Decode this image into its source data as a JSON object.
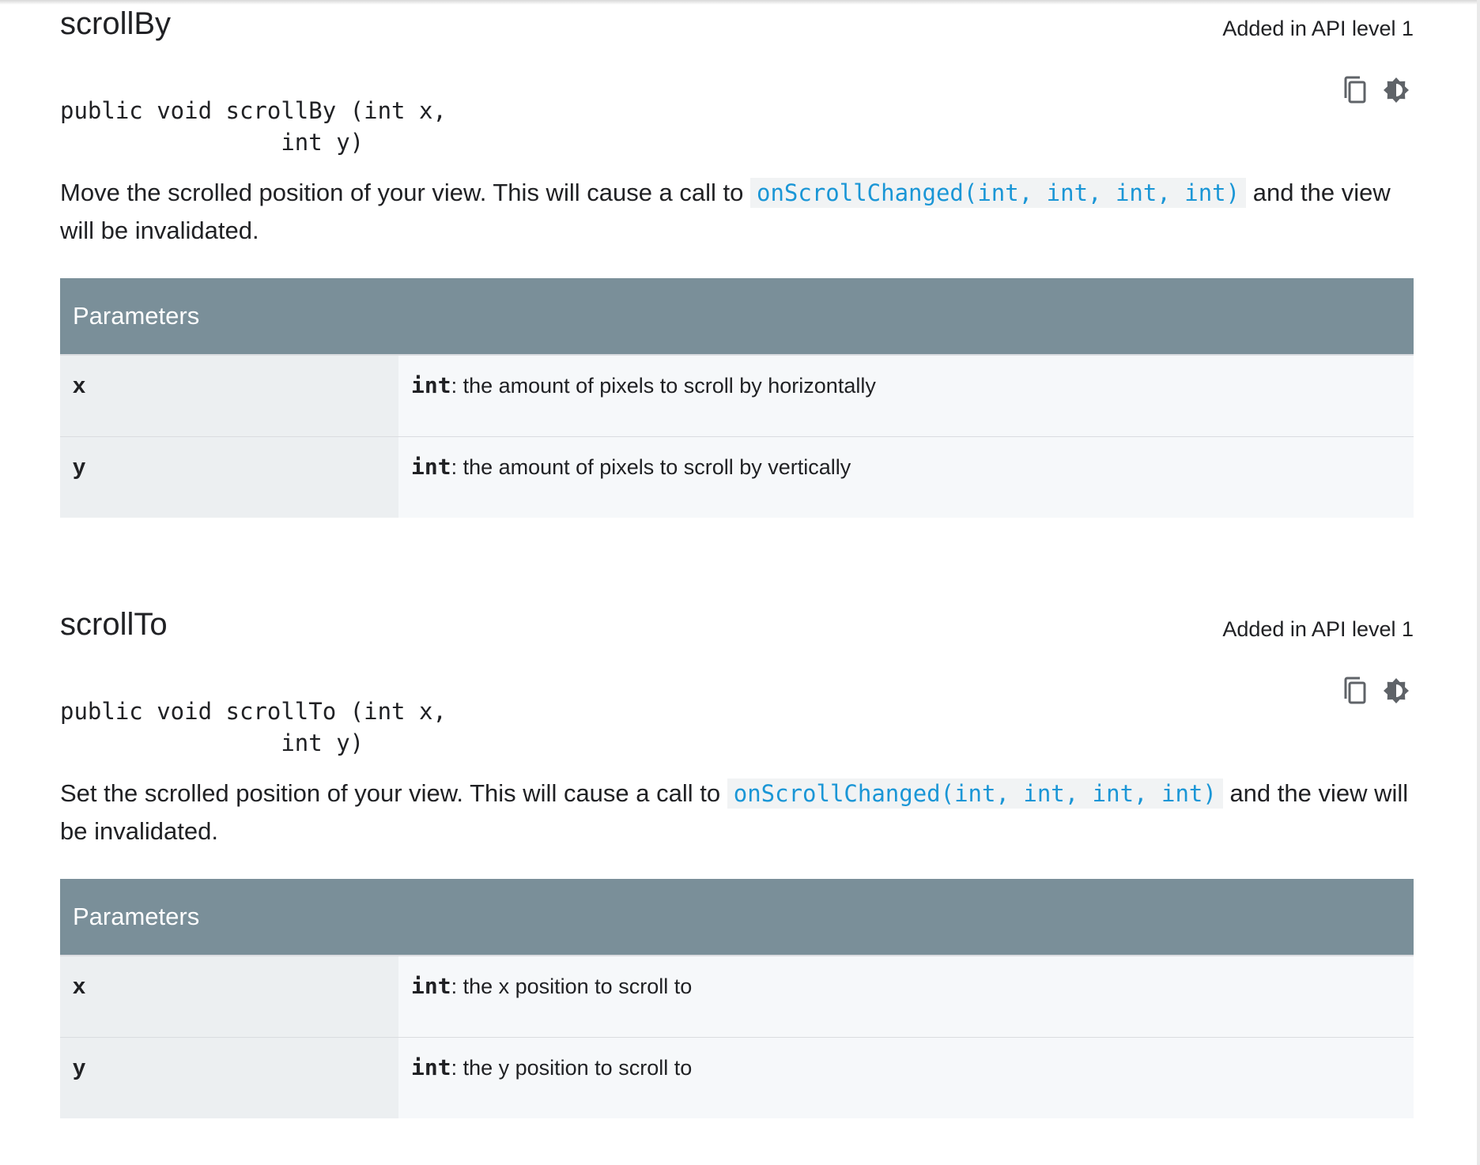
{
  "methods": [
    {
      "name": "scrollBy",
      "api_level": "Added in API level 1",
      "signature_line1": "public void scrollBy (int x,",
      "signature_line2": "                int y)",
      "desc_before": "Move the scrolled position of your view. This will cause a call to ",
      "desc_link": "onScrollChanged(int, int, int, int)",
      "desc_after": " and the view will be invalidated.",
      "params_header": "Parameters",
      "params": [
        {
          "name": "x",
          "type": "int",
          "desc": ": the amount of pixels to scroll by horizontally"
        },
        {
          "name": "y",
          "type": "int",
          "desc": ": the amount of pixels to scroll by vertically"
        }
      ]
    },
    {
      "name": "scrollTo",
      "api_level": "Added in API level 1",
      "signature_line1": "public void scrollTo (int x,",
      "signature_line2": "                int y)",
      "desc_before": "Set the scrolled position of your view. This will cause a call to ",
      "desc_link": "onScrollChanged(int, int, int, int)",
      "desc_after": " and the view will be invalidated.",
      "params_header": "Parameters",
      "params": [
        {
          "name": "x",
          "type": "int",
          "desc": ": the x position to scroll to"
        },
        {
          "name": "y",
          "type": "int",
          "desc": ": the y position to scroll to"
        }
      ]
    }
  ],
  "icons": {
    "copy": "copy-icon",
    "theme": "dark-mode-icon"
  },
  "colors": {
    "header_bg": "#7a8f99",
    "link": "#1a96d6",
    "name_cell_bg": "#eceff1",
    "desc_cell_bg": "#f6f8fa"
  }
}
